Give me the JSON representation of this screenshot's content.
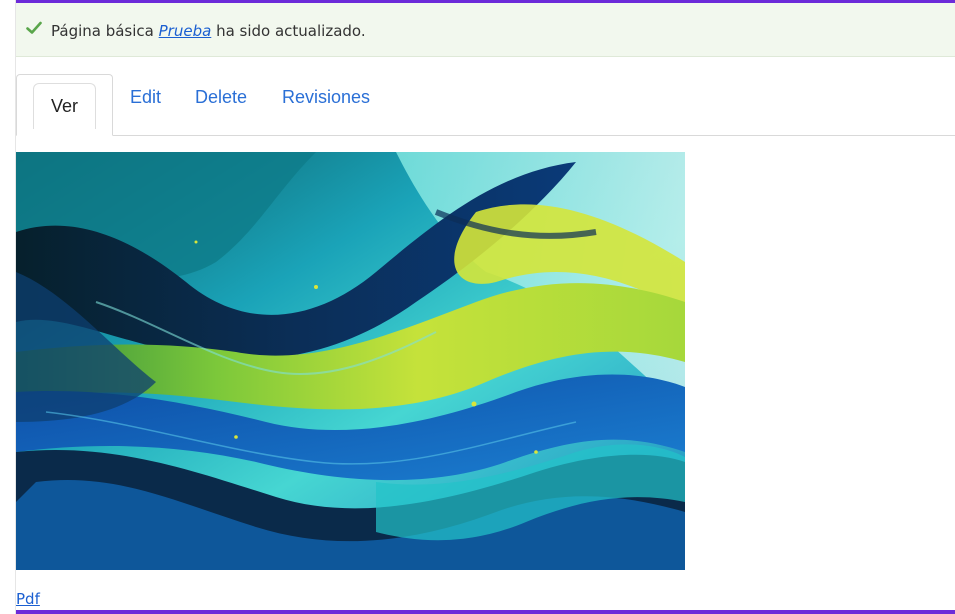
{
  "status": {
    "prefix": "Página básica ",
    "link_text": "Prueba",
    "suffix": " ha sido actualizado.",
    "icon": "check-icon",
    "color": "#5aa64b"
  },
  "tabs": [
    {
      "label": "Ver",
      "active": true
    },
    {
      "label": "Edit",
      "active": false
    },
    {
      "label": "Delete",
      "active": false
    },
    {
      "label": "Revisiones",
      "active": false
    }
  ],
  "image": {
    "alt": "acer"
  },
  "attachment": {
    "label": "Pdf"
  },
  "colors": {
    "accent": "#6c2bd9",
    "link": "#2a6fd6",
    "message_bg": "#f2f8ee"
  }
}
